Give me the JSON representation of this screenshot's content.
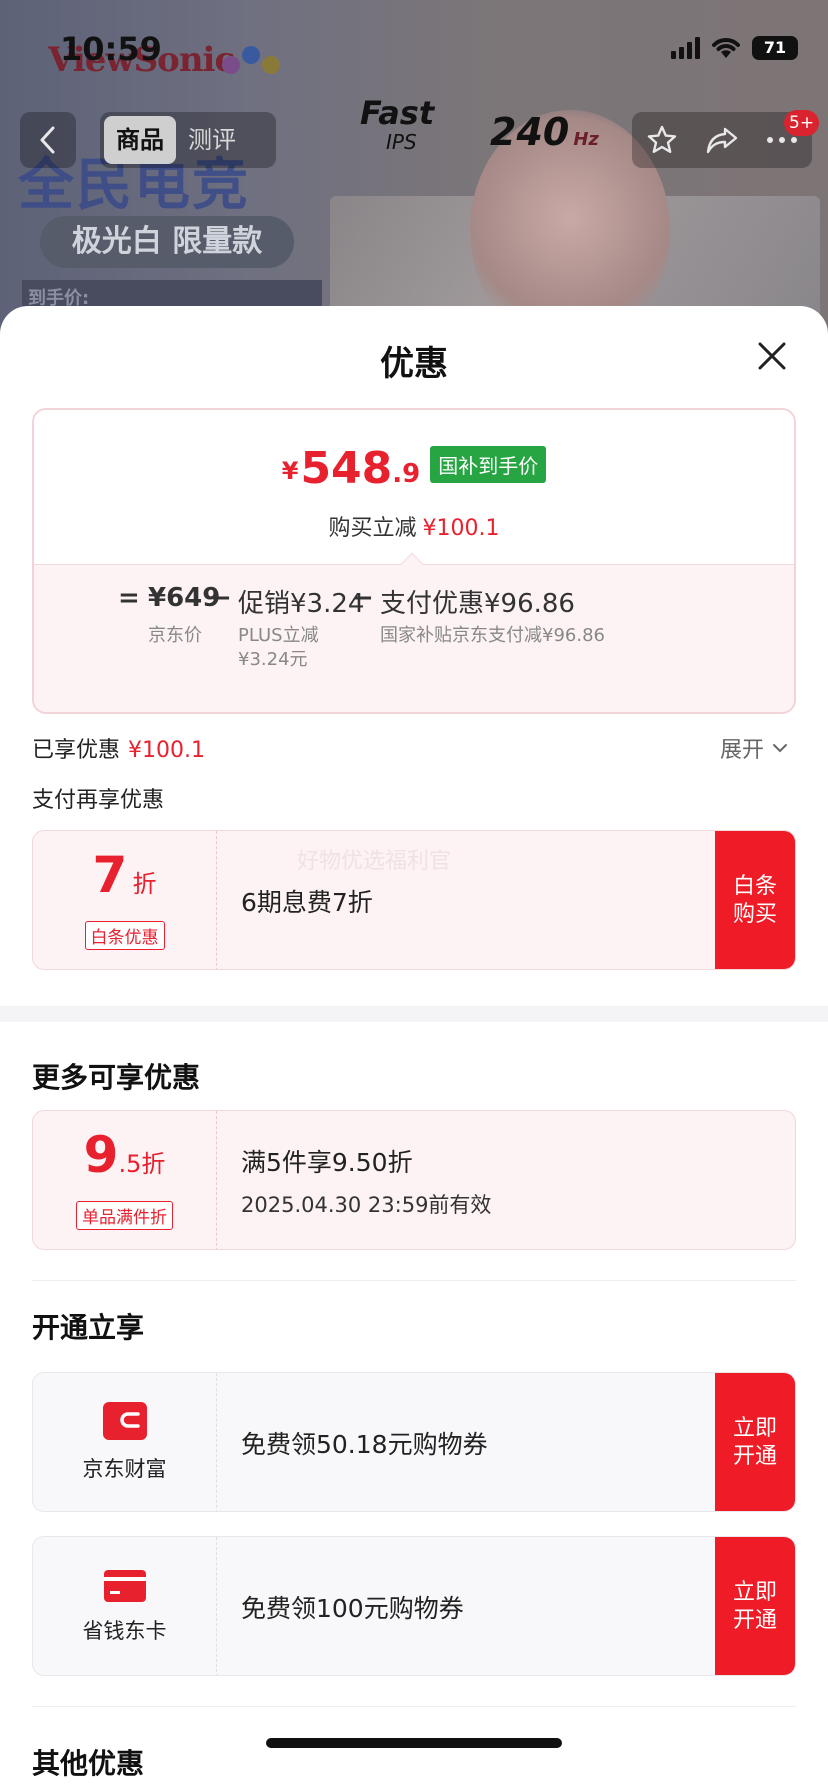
{
  "status_bar": {
    "time": "10:59",
    "battery": "71"
  },
  "background": {
    "brand": "ViewSonic",
    "fast": "Fast",
    "ips": "IPS",
    "refresh": "240",
    "refresh_unit": "Hz",
    "headline": "全民电竞",
    "edition": "极光白 限量款",
    "price_hint": "到手价:"
  },
  "nav": {
    "tabs": [
      "商品",
      "测评"
    ],
    "active_tab": 0,
    "badge": "5+"
  },
  "sheet": {
    "title": "优惠",
    "price": {
      "currency": "¥",
      "integer": "548",
      "decimal": ".9",
      "tag": "国补到手价",
      "reduce_label": "购买立减",
      "reduce_value": "¥100.1"
    },
    "breakdown": {
      "eq": "=",
      "jd_price": "¥649",
      "jd_price_label": "京东价",
      "minus1": "−",
      "promo": "促销¥3.24",
      "promo_label_1": "PLUS立减",
      "promo_label_2": "¥3.24元",
      "minus2": "−",
      "pay": "支付优惠¥96.86",
      "pay_label": "国家补贴京东支付减¥96.86"
    },
    "enjoyed_label": "已享优惠",
    "enjoyed_value": "¥100.1",
    "expand_label": "展开",
    "pay_again_label": "支付再享优惠",
    "baitiao": {
      "num": "7",
      "unit": "折",
      "tag": "白条优惠",
      "text": "6期息费7折",
      "watermark": "好物优选福利官",
      "button_line1": "白条",
      "button_line2": "购买"
    },
    "more_title": "更多可享优惠",
    "discount": {
      "num": "9",
      "num_small": ".5折",
      "tag": "单品满件折",
      "text": "满5件享9.50折",
      "expiry": "2025.04.30 23:59前有效"
    },
    "open_title": "开通立享",
    "open_items": [
      {
        "name": "京东财富",
        "text": "免费领50.18元购物券",
        "button_line1": "立即",
        "button_line2": "开通",
        "icon": "wallet-icon"
      },
      {
        "name": "省钱东卡",
        "text": "免费领100元购物券",
        "button_line1": "立即",
        "button_line2": "开通",
        "icon": "card-icon"
      }
    ],
    "other_title": "其他优惠"
  },
  "colors": {
    "accent_red": "#e8212f",
    "button_red": "#ef1c27",
    "tag_green": "#27a543"
  }
}
